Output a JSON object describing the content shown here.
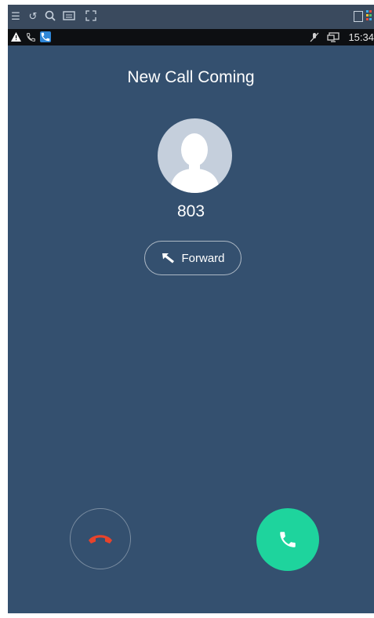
{
  "status_bar": {
    "time": "15:34"
  },
  "call": {
    "title": "New Call Coming",
    "caller_number": "803",
    "forward_label": "Forward"
  },
  "colors": {
    "background": "#34506f",
    "answer": "#1ed49d",
    "decline_icon": "#e8432b",
    "avatar": "#c5cfdc"
  },
  "icons": {
    "viewer_bar": [
      "menu-icon",
      "refresh-icon",
      "zoom-icon",
      "keyboard-icon",
      "fullscreen-icon",
      "exit-icon",
      "color-grid-icon"
    ],
    "status_bar": [
      "warning-icon",
      "phone-icon",
      "app-phone-icon",
      "mute-icon",
      "screen-icon"
    ],
    "call": [
      "avatar-icon",
      "forward-icon",
      "decline-icon",
      "answer-icon"
    ]
  }
}
